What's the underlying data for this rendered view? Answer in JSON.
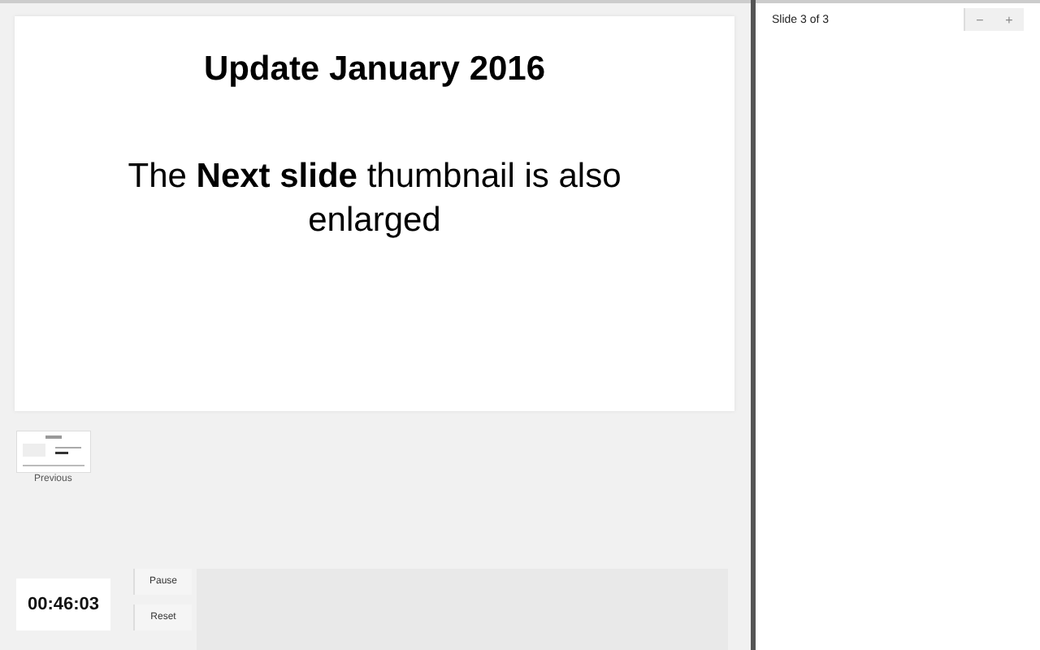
{
  "slide": {
    "title": "Update January 2016",
    "body": "The **Next slide** thumbnail is also enlarged"
  },
  "previous": {
    "label": "Previous"
  },
  "timer": {
    "time": "00:46:03"
  },
  "buttons": [
    "Pause",
    "Reset"
  ],
  "notes": {
    "counter": "Slide 3 of 3",
    "zoom_buttons": [
      "−",
      "+"
    ]
  }
}
